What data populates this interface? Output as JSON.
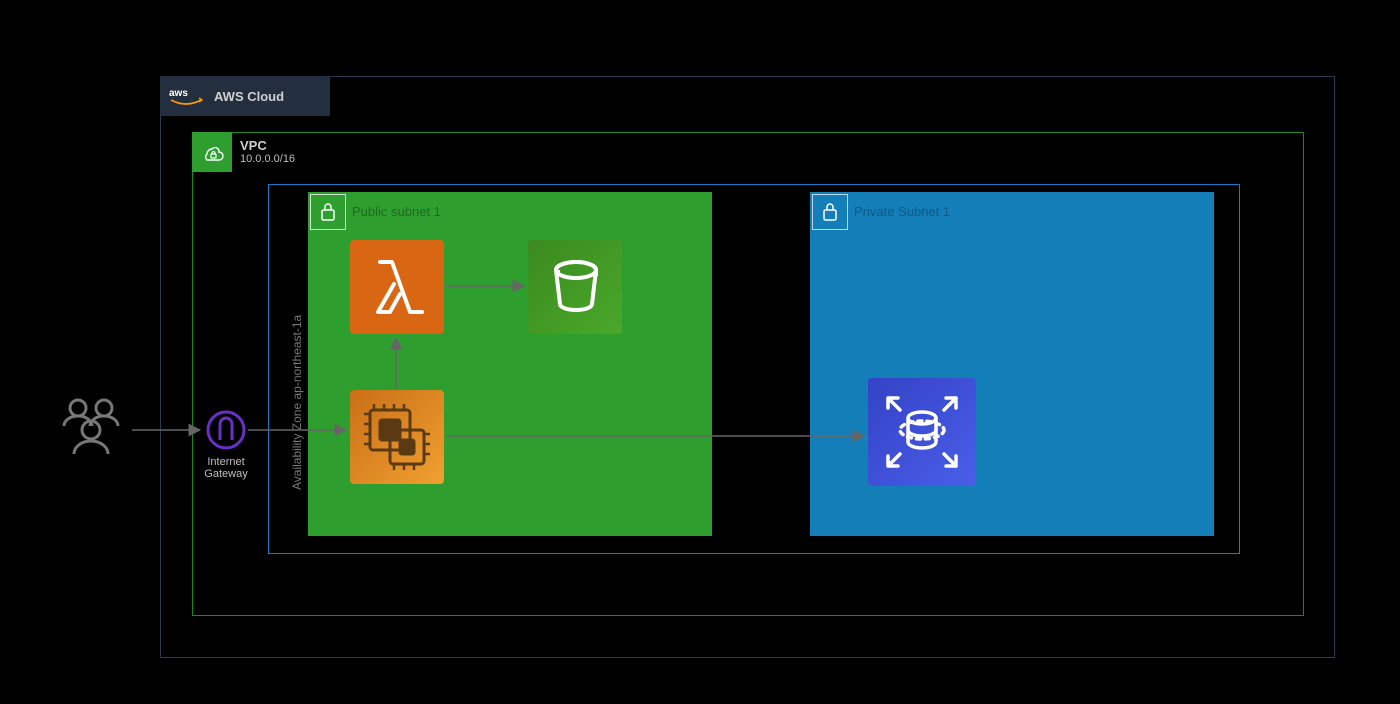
{
  "cloud": {
    "title": "AWS Cloud"
  },
  "vpc": {
    "title": "VPC",
    "cidr": "10.0.0.0/16"
  },
  "az": {
    "label": "Availability Zone  ap-northeast-1a"
  },
  "subnets": {
    "public": {
      "title": "Public subnet 1"
    },
    "private": {
      "title": "Private Subnet 1"
    }
  },
  "gateway": {
    "label1": "Internet",
    "label2": "Gateway"
  },
  "colors": {
    "cloudBorder": "#2a3a4f",
    "vpcBorder": "#1e8a1e",
    "vpcTab": "#2e9e2e",
    "azBorder": "#1e78c8",
    "publicFill": "#2e9e2e",
    "privateFill": "#147eb8",
    "lambda": "#d86613",
    "s3a": "#3b8a1e",
    "s3b": "#4aa82a",
    "ec2": "#e58a1f",
    "rds": "#3f51d8",
    "igw": "#6a2fc7",
    "arrow": "#666666",
    "awsTab": "#232f3e"
  },
  "services": {
    "lambda": "AWS Lambda",
    "s3": "Amazon S3",
    "ec2": "Amazon EC2",
    "rds": "Amazon RDS (scalable)"
  },
  "actors": {
    "users": "Users"
  }
}
